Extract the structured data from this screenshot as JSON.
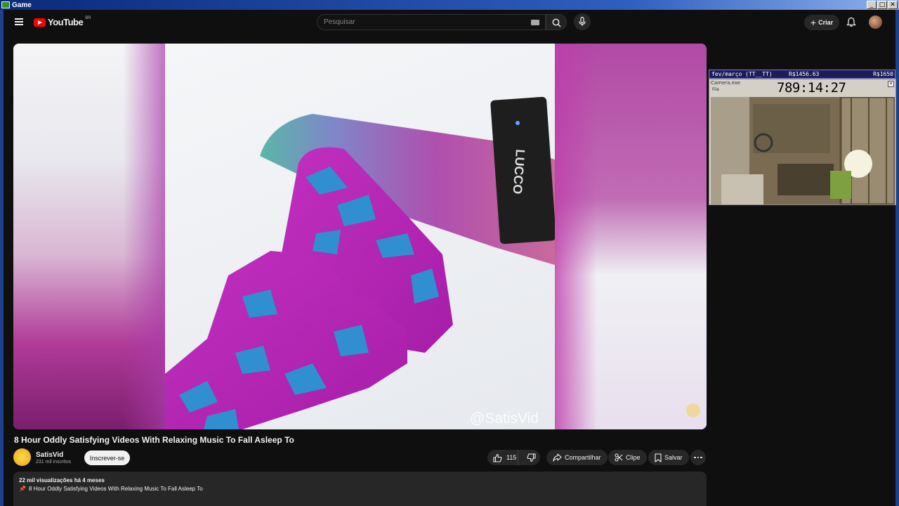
{
  "window": {
    "title": "Game",
    "buttons": [
      "_",
      "□",
      "✕"
    ]
  },
  "header": {
    "logo_text": "YouTube",
    "region_code": "BR",
    "search_placeholder": "Pesquisar",
    "create_label": "Criar"
  },
  "player": {
    "watermark": "@SatisVid"
  },
  "overlay": {
    "period_label": "fev/março (TT__TT)",
    "amount_current": "R$1456.63",
    "amount_goal": "R$1650",
    "camera_title": "Camera.exe",
    "camera_menu": "File",
    "timer": "789:14:27"
  },
  "video": {
    "title": "8 Hour Oddly Satisfying Videos With Relaxing Music To Fall Asleep To",
    "channel_name": "SatisVid",
    "subscribers": "231 mil inscritos",
    "subscribe_label": "Inscrever-se",
    "likes": "115",
    "share_label": "Compartilhar",
    "clip_label": "Clipe",
    "save_label": "Salvar"
  },
  "description": {
    "meta": "22 mil visualizações  há 4 meses",
    "first_line": "8 Hour Oddly Satisfying Videos With Relaxing Music To Fall Asleep To"
  },
  "colors": {
    "background": "#0f0f0f",
    "brand_red": "#ff0000",
    "pill": "#272727"
  }
}
